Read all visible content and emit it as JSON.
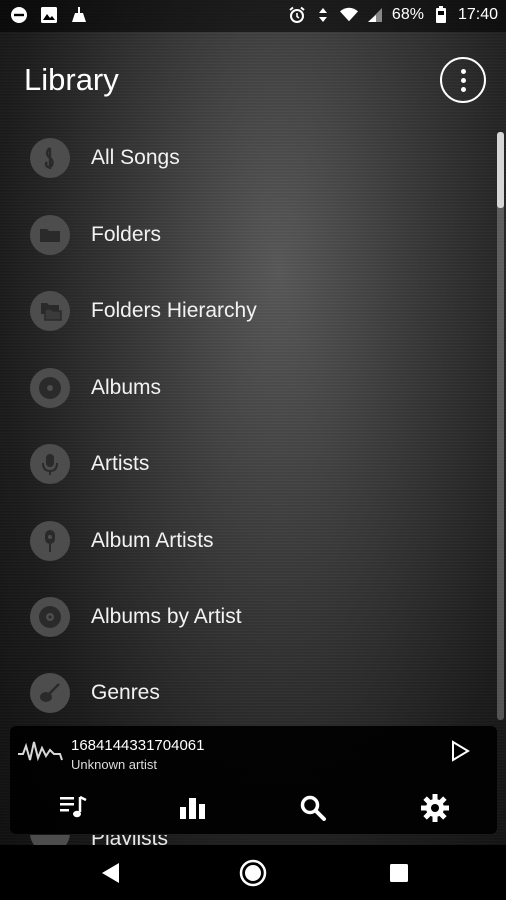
{
  "status_bar": {
    "battery": "68%",
    "time": "17:40",
    "icons_left": [
      "do-not-disturb-icon",
      "image-icon",
      "cleaner-icon"
    ],
    "icons_right": [
      "alarm-icon",
      "data-arrows-icon",
      "wifi-icon",
      "signal-icon",
      "battery-icon"
    ]
  },
  "header": {
    "title": "Library",
    "menu_icon": "more-vert-icon"
  },
  "library": {
    "items": [
      {
        "label": "All Songs",
        "icon": "treble-clef-icon"
      },
      {
        "label": "Folders",
        "icon": "folder-icon"
      },
      {
        "label": "Folders Hierarchy",
        "icon": "folder-tree-icon"
      },
      {
        "label": "Albums",
        "icon": "disc-icon"
      },
      {
        "label": "Artists",
        "icon": "microphone-icon"
      },
      {
        "label": "Album Artists",
        "icon": "microphone-album-icon"
      },
      {
        "label": "Albums by Artist",
        "icon": "disc-artist-icon"
      },
      {
        "label": "Genres",
        "icon": "guitar-icon"
      }
    ],
    "partial_item": {
      "label": "Playlists",
      "icon": "playlist-icon"
    }
  },
  "player": {
    "track_title": "1684144331704061",
    "track_artist": "Unknown artist",
    "wave_icon": "waveform-icon",
    "play_icon": "play-icon",
    "tabs": [
      {
        "name": "library-tab",
        "icon": "music-library-icon"
      },
      {
        "name": "equalizer-tab",
        "icon": "equalizer-icon"
      },
      {
        "name": "search-tab",
        "icon": "search-icon"
      },
      {
        "name": "settings-tab",
        "icon": "gear-icon"
      }
    ]
  },
  "nav_bar": {
    "back": "back-icon",
    "home": "home-icon",
    "recents": "recents-icon"
  }
}
